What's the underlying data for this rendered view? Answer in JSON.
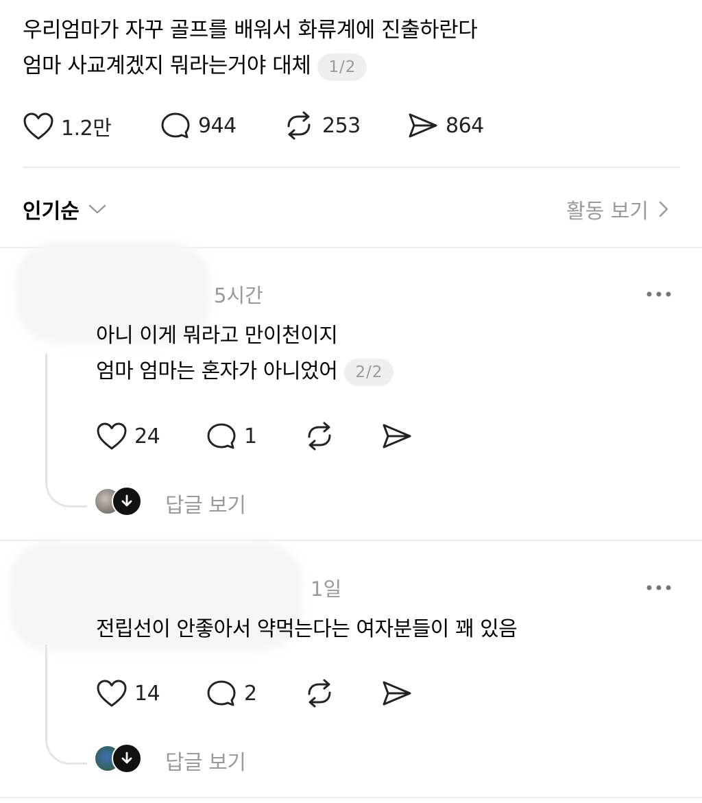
{
  "post": {
    "lines": [
      "우리엄마가 자꾸 골프를 배워서 화류계에 진출하란다",
      "엄마 사교계겠지 뭐라는거야 대체"
    ],
    "page_indicator": "1/2",
    "actions": {
      "likes": "1.2만",
      "replies": "944",
      "reposts": "253",
      "shares": "864"
    }
  },
  "sort": {
    "label": "인기순"
  },
  "activity": {
    "label": "활동 보기"
  },
  "comments": [
    {
      "time": "5시간",
      "lines": [
        "아니 이게 뭐라고 만이천이지",
        "엄마 엄마는 혼자가 아니었어"
      ],
      "page_indicator": "2/2",
      "likes": "24",
      "replies": "1",
      "view_replies": "답글 보기"
    },
    {
      "time": "1일",
      "lines": [
        "전립선이 안좋아서 약먹는다는 여자분들이 꽤 있음"
      ],
      "likes": "14",
      "replies": "2",
      "view_replies": "답글 보기"
    }
  ],
  "icons": {
    "like": "heart-icon",
    "reply": "speech-bubble-icon",
    "repost": "repost-arrows-icon",
    "share": "send-icon",
    "more": "ellipsis-icon",
    "sort": "chevron-down-icon",
    "activity": "chevron-right-icon",
    "expand": "arrow-down-icon"
  },
  "colors": {
    "text": "#000000",
    "muted": "#9a9a9a",
    "divider": "#ececec"
  }
}
